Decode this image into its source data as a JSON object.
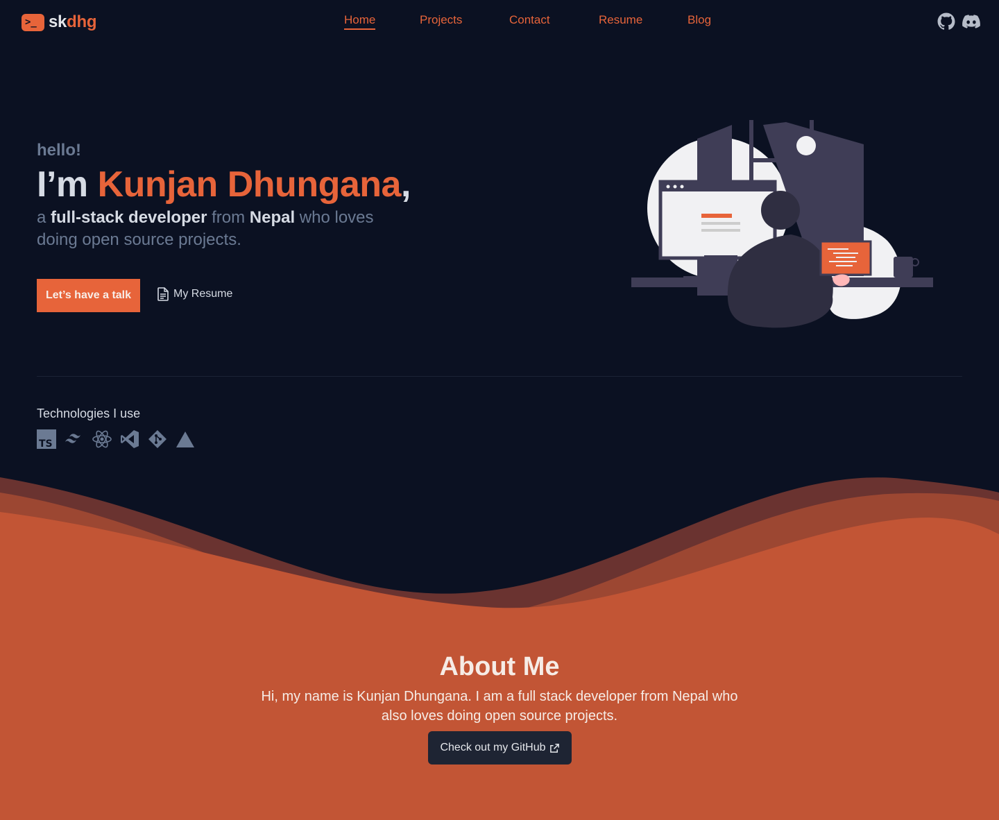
{
  "nav": {
    "logo_part1": "sk",
    "logo_part2": "dhg",
    "logo_prompt": ">_",
    "links": [
      {
        "label": "Home",
        "active": true
      },
      {
        "label": "Projects"
      },
      {
        "label": "Contact"
      },
      {
        "label": "Resume"
      },
      {
        "label": "Blog"
      }
    ],
    "social": [
      "github-icon",
      "discord-icon"
    ]
  },
  "hero": {
    "greeting": "hello!",
    "heading_prefix": "I’m ",
    "name": "Kunjan Dhungana",
    "heading_suffix": ",",
    "tagline_a": "a ",
    "tagline_role": "full-stack developer",
    "tagline_from": " from ",
    "tagline_country": "Nepal",
    "tagline_rest": " who loves doing open source projects.",
    "cta_primary": "Let’s have a talk",
    "cta_secondary": "My Resume"
  },
  "technologies": {
    "title": "Technologies I use",
    "icons": [
      "typescript-icon",
      "tailwind-icon",
      "react-icon",
      "vscode-icon",
      "git-icon",
      "vercel-icon"
    ]
  },
  "about": {
    "title": "About Me",
    "text": "Hi, my name is Kunjan Dhungana. I am a full stack developer from Nepal who also loves doing open source projects.",
    "button": "Check out my GitHub"
  },
  "colors": {
    "background": "#0b1122",
    "accent": "#e7643a",
    "muted": "#6b7a93",
    "about_bg": "#c25535"
  }
}
